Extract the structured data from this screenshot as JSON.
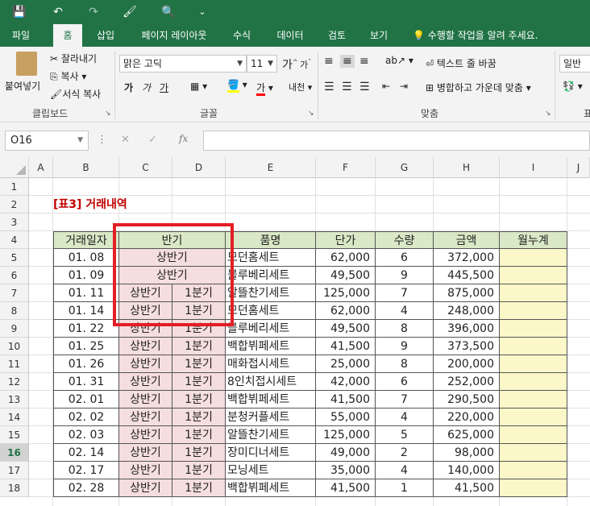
{
  "quick_access": {
    "save": "💾",
    "undo": "↶",
    "redo": "↷",
    "custom": "🖌",
    "preview": "🔍",
    "more": "⌄"
  },
  "tabs": [
    {
      "label": "파일"
    },
    {
      "label": "홈"
    },
    {
      "label": "삽입"
    },
    {
      "label": "페이지 레이아웃"
    },
    {
      "label": "수식"
    },
    {
      "label": "데이터"
    },
    {
      "label": "검토"
    },
    {
      "label": "보기"
    }
  ],
  "tell_me": "수행할 작업을 알려 주세요.",
  "ribbon": {
    "clipboard": {
      "paste": "붙여넣기",
      "cut": "잘라내기",
      "copy": "복사",
      "format_painter": "서식 복사",
      "label": "클립보드"
    },
    "font": {
      "name": "맑은 고딕",
      "size": "11",
      "label": "글꼴",
      "bold": "가",
      "italic": "가",
      "underline": "가",
      "grow": "가",
      "shrink": "가",
      "color": "가",
      "phonetic": "내천"
    },
    "align": {
      "wrap": "텍스트 줄 바꿈",
      "merge": "병합하고 가운데 맞춤",
      "label": "맞춤"
    },
    "number": {
      "format": "일반",
      "label": "표"
    }
  },
  "formula_bar": {
    "name_box": "O16",
    "fx": "fx",
    "cancel": "✕",
    "enter": "✓",
    "value": ""
  },
  "columns": [
    "A",
    "B",
    "C",
    "D",
    "E",
    "F",
    "G",
    "H",
    "I",
    "J"
  ],
  "rows": [
    "1",
    "2",
    "3",
    "4",
    "5",
    "6",
    "7",
    "8",
    "9",
    "10",
    "11",
    "12",
    "13",
    "14",
    "15",
    "16",
    "17",
    "18"
  ],
  "selected_row": "16",
  "sheet": {
    "title": "[표3] 거래내역",
    "headers": {
      "date": "거래일자",
      "half": "반기",
      "product": "품명",
      "price": "단가",
      "qty": "수량",
      "amount": "금액",
      "cumulative": "월누계"
    },
    "data_rows": [
      {
        "date": "01. 08",
        "half": "상반기",
        "quarter": "",
        "product": "모던홈세트",
        "price": "62,000",
        "qty": "6",
        "amount": "372,000"
      },
      {
        "date": "01. 09",
        "half": "상반기",
        "quarter": "",
        "product": "블루베리세트",
        "price": "49,500",
        "qty": "9",
        "amount": "445,500"
      },
      {
        "date": "01. 11",
        "half": "상반기",
        "quarter": "1분기",
        "product": "알뜰찬기세트",
        "price": "125,000",
        "qty": "7",
        "amount": "875,000"
      },
      {
        "date": "01. 14",
        "half": "상반기",
        "quarter": "1분기",
        "product": "모던홈세트",
        "price": "62,000",
        "qty": "4",
        "amount": "248,000"
      },
      {
        "date": "01. 22",
        "half": "상반기",
        "quarter": "1분기",
        "product": "블루베리세트",
        "price": "49,500",
        "qty": "8",
        "amount": "396,000"
      },
      {
        "date": "01. 25",
        "half": "상반기",
        "quarter": "1분기",
        "product": "백합뷔페세트",
        "price": "41,500",
        "qty": "9",
        "amount": "373,500"
      },
      {
        "date": "01. 26",
        "half": "상반기",
        "quarter": "1분기",
        "product": "매화접시세트",
        "price": "25,000",
        "qty": "8",
        "amount": "200,000"
      },
      {
        "date": "01. 31",
        "half": "상반기",
        "quarter": "1분기",
        "product": "8인치접시세트",
        "price": "42,000",
        "qty": "6",
        "amount": "252,000"
      },
      {
        "date": "02. 01",
        "half": "상반기",
        "quarter": "1분기",
        "product": "백합뷔페세트",
        "price": "41,500",
        "qty": "7",
        "amount": "290,500"
      },
      {
        "date": "02. 02",
        "half": "상반기",
        "quarter": "1분기",
        "product": "분청커플세트",
        "price": "55,000",
        "qty": "4",
        "amount": "220,000"
      },
      {
        "date": "02. 03",
        "half": "상반기",
        "quarter": "1분기",
        "product": "알뜰찬기세트",
        "price": "125,000",
        "qty": "5",
        "amount": "625,000"
      },
      {
        "date": "02. 14",
        "half": "상반기",
        "quarter": "1분기",
        "product": "장미디너세트",
        "price": "49,000",
        "qty": "2",
        "amount": "98,000"
      },
      {
        "date": "02. 17",
        "half": "상반기",
        "quarter": "1분기",
        "product": "모닝세트",
        "price": "35,000",
        "qty": "4",
        "amount": "140,000"
      },
      {
        "date": "02. 28",
        "half": "상반기",
        "quarter": "1분기",
        "product": "백합뷔페세트",
        "price": "41,500",
        "qty": "1",
        "amount": "41,500"
      }
    ]
  },
  "colors": {
    "brand": "#217346",
    "header_fill": "#d9e8c6",
    "half_fill": "#f5dede",
    "cumulative_fill": "#fbf7c8",
    "title": "#c00000",
    "highlight_box": "#e31e24"
  }
}
